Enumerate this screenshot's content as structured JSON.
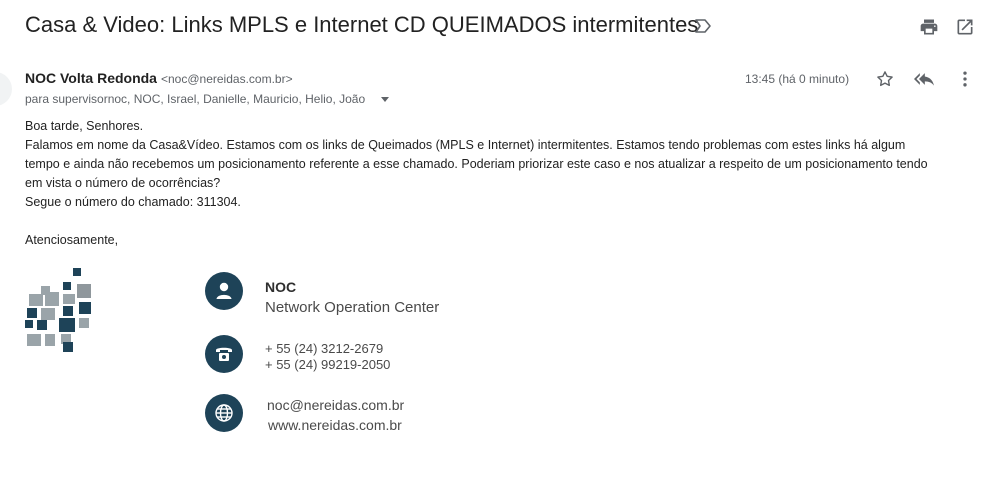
{
  "email": {
    "subject": "Casa & Video: Links MPLS e Internet CD QUEIMADOS intermitentes",
    "sender_name": "NOC Volta Redonda",
    "sender_email": "<noc@nereidas.com.br>",
    "recipients": "para supervisornoc, NOC, Israel, Danielle, Mauricio, Helio, João",
    "timestamp": "13:45 (há 0 minuto)",
    "body": [
      "Boa tarde, Senhores.",
      "Falamos em nome da Casa&Vídeo. Estamos com os links  de Queimados (MPLS e Internet) intermitentes. Estamos tendo problemas com estes links há algum",
      "tempo e ainda não recebemos um posicionamento referente a esse chamado. Poderiam priorizar este caso e nos atualizar a respeito de um posicionamento tendo",
      "em vista o número de ocorrências?",
      "Segue o número do chamado: 311304.",
      "Atenciosamente,"
    ]
  },
  "signature": {
    "title": "NOC",
    "subtitle": "Network Operation Center",
    "phone1": "+ 55 (24) 3212-2679",
    "phone2": "+ 55 (24) 99219-2050",
    "email": "noc@nereidas.com.br",
    "website": "www.nereidas.com.br",
    "brand_color": "#1e4358"
  },
  "icons": {
    "toolbar": [
      "print-icon",
      "open-in-new-window-icon"
    ],
    "message": [
      "star-icon",
      "reply-all-icon",
      "more-vert-icon"
    ],
    "subject": "label-important-icon"
  }
}
